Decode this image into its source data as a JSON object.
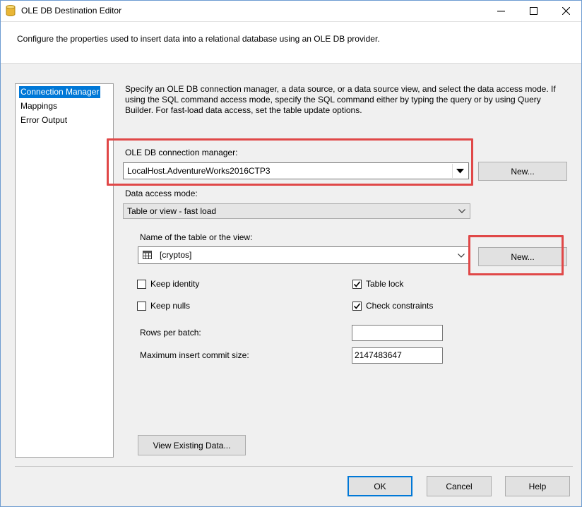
{
  "window": {
    "title": "OLE DB Destination Editor",
    "minimize_glyph": "—",
    "maximize_glyph": "☐",
    "close_glyph": "✕"
  },
  "header": {
    "description": "Configure the properties used to insert data into a relational database using an OLE DB provider."
  },
  "nav": {
    "items": [
      {
        "label": "Connection Manager",
        "selected": true
      },
      {
        "label": "Mappings",
        "selected": false
      },
      {
        "label": "Error Output",
        "selected": false
      }
    ]
  },
  "main": {
    "description": "Specify an OLE DB connection manager, a data source, or a data source view, and select the data access mode. If using the SQL command access mode, specify the SQL command either by typing the query or by using Query Builder. For fast-load data access, set the table update options.",
    "connection_label": "OLE DB connection manager:",
    "connection_value": "LocalHost.AdventureWorks2016CTP3",
    "connection_new_button": "New...",
    "access_mode_label": "Data access mode:",
    "access_mode_value": "Table or view - fast load",
    "table_label": "Name of the table or the view:",
    "table_value": "[cryptos]",
    "table_new_button": "New...",
    "options": {
      "keep_identity": {
        "label": "Keep identity",
        "checked": false
      },
      "keep_nulls": {
        "label": "Keep nulls",
        "checked": false
      },
      "table_lock": {
        "label": "Table lock",
        "checked": true
      },
      "check_constraints": {
        "label": "Check constraints",
        "checked": true
      }
    },
    "rows_per_batch_label": "Rows per batch:",
    "rows_per_batch_value": "",
    "max_commit_label": "Maximum insert commit size:",
    "max_commit_value": "2147483647",
    "view_data_button": "View Existing Data..."
  },
  "footer": {
    "ok": "OK",
    "cancel": "Cancel",
    "help": "Help"
  },
  "colors": {
    "selection": "#0078d7",
    "highlight_box": "#e04848"
  },
  "icons": {
    "title": "database-cylinder-icon",
    "table": "table-grid-icon"
  }
}
